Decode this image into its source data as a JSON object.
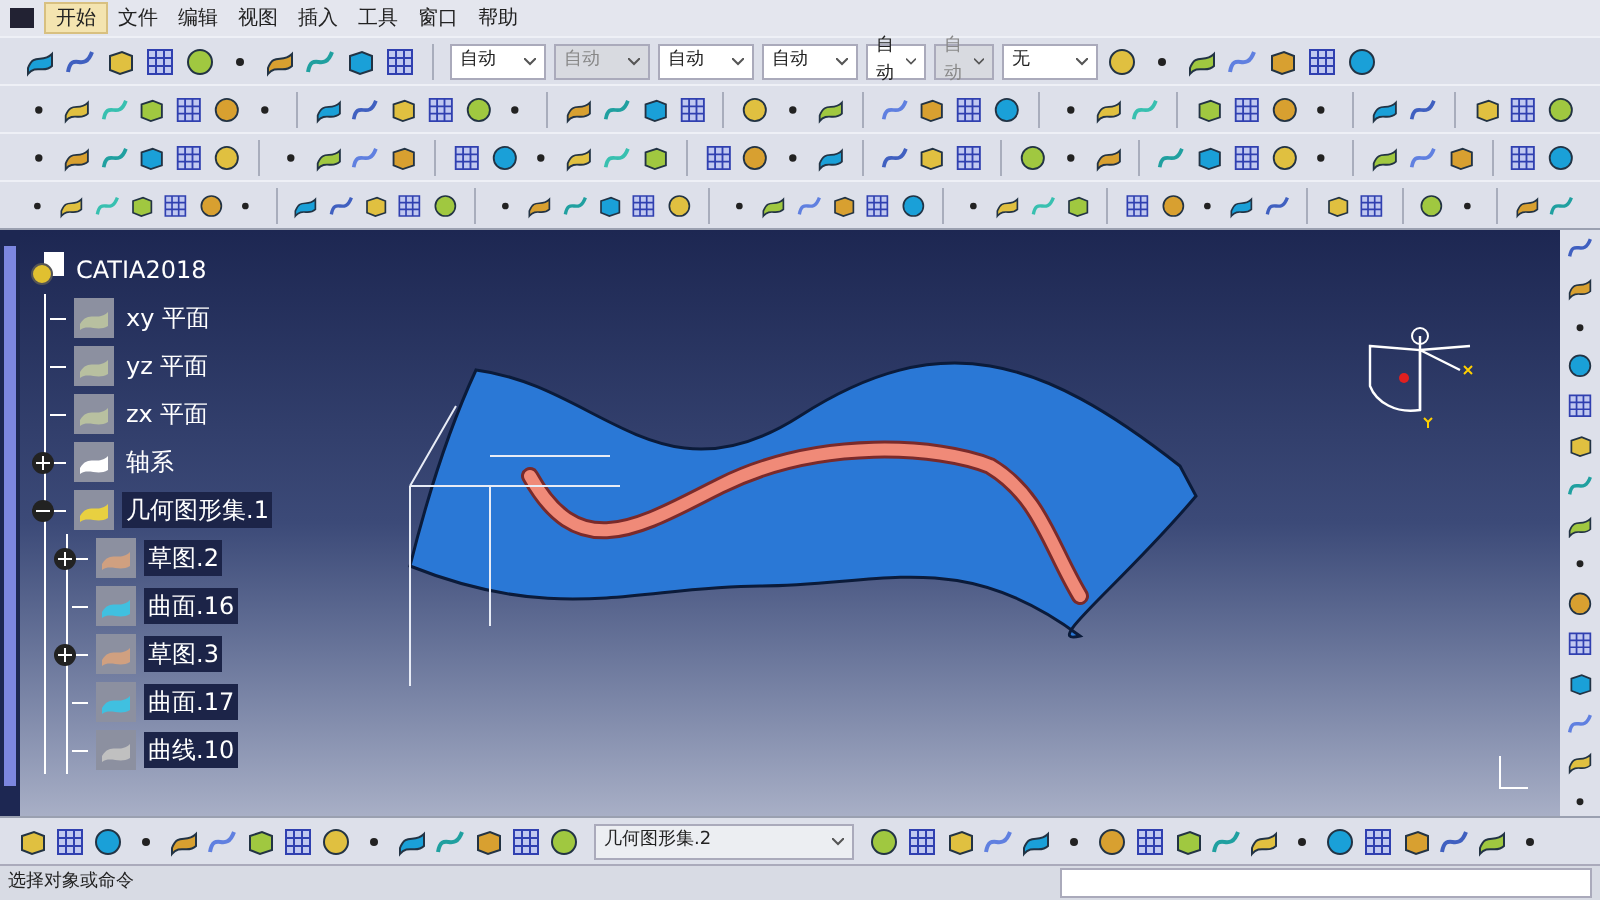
{
  "menu": [
    {
      "label": "开始",
      "selected": true
    },
    {
      "label": "文件",
      "selected": false
    },
    {
      "label": "编辑",
      "selected": false
    },
    {
      "label": "视图",
      "selected": false
    },
    {
      "label": "插入",
      "selected": false
    },
    {
      "label": "工具",
      "selected": false
    },
    {
      "label": "窗口",
      "selected": false
    },
    {
      "label": "帮助",
      "selected": false
    }
  ],
  "dropdowns": [
    {
      "value": "自动",
      "disabled": false
    },
    {
      "value": "自动",
      "disabled": true
    },
    {
      "value": "自动",
      "disabled": false
    },
    {
      "value": "自动",
      "disabled": false
    },
    {
      "value": "自动",
      "disabled": false
    },
    {
      "value": "自动",
      "disabled": true
    },
    {
      "value": "无",
      "disabled": false
    }
  ],
  "tree": {
    "label": "CATIA2018",
    "children": [
      {
        "label": "xy 平面",
        "kind": "plane",
        "selected": false
      },
      {
        "label": "yz 平面",
        "kind": "plane",
        "selected": false
      },
      {
        "label": "zx 平面",
        "kind": "plane",
        "selected": false
      },
      {
        "label": "轴系",
        "kind": "axis",
        "expanded": false,
        "selected": false
      },
      {
        "label": "几何图形集.1",
        "kind": "set",
        "expanded": true,
        "selected": true,
        "children": [
          {
            "label": "草图.2",
            "kind": "sketch",
            "expanded": false,
            "selected": true
          },
          {
            "label": "曲面.16",
            "kind": "surface",
            "selected": true
          },
          {
            "label": "草图.3",
            "kind": "sketch",
            "expanded": false,
            "selected": true
          },
          {
            "label": "曲面.17",
            "kind": "surface",
            "selected": true
          },
          {
            "label": "曲线.10",
            "kind": "curve",
            "selected": true
          }
        ]
      }
    ]
  },
  "bottom_toolbar": {
    "body_select": "几何图形集.2"
  },
  "status_bar": {
    "message": "选择对象或命令"
  }
}
